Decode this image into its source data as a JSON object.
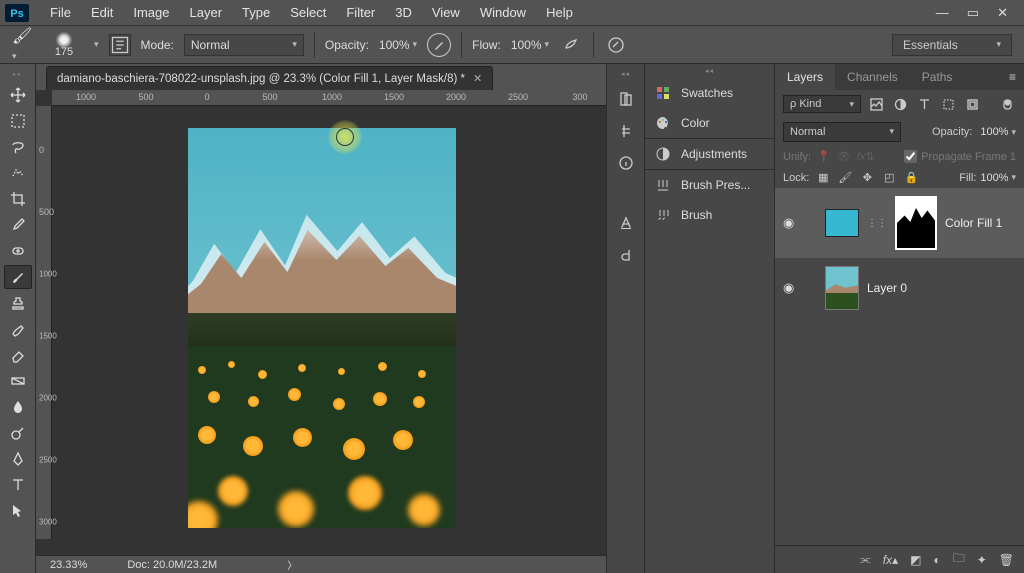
{
  "menubar": {
    "items": [
      "File",
      "Edit",
      "Image",
      "Layer",
      "Type",
      "Select",
      "Filter",
      "3D",
      "View",
      "Window",
      "Help"
    ]
  },
  "options": {
    "brush_size": "175",
    "mode_label": "Mode:",
    "mode_value": "Normal",
    "opacity_label": "Opacity:",
    "opacity_value": "100%",
    "flow_label": "Flow:",
    "flow_value": "100%"
  },
  "workspace": {
    "value": "Essentials"
  },
  "document": {
    "tab_title": "damiano-baschiera-708022-unsplash.jpg @ 23.3% (Color Fill 1, Layer Mask/8) *",
    "hruler_ticks": [
      "1000",
      "500",
      "0",
      "500",
      "1000",
      "1500",
      "2000",
      "2500",
      "300"
    ],
    "vruler_ticks": [
      "0",
      "500",
      "1000",
      "1500",
      "2000",
      "2500",
      "3000"
    ]
  },
  "status": {
    "zoom": "23.33%",
    "doc": "Doc: 20.0M/23.2M"
  },
  "panels": {
    "swatches": "Swatches",
    "color": "Color",
    "adjustments": "Adjustments",
    "brush_presets": "Brush Pres...",
    "brush": "Brush"
  },
  "layers_panel": {
    "tabs": [
      "Layers",
      "Channels",
      "Paths"
    ],
    "filter_kind_label": "Kind",
    "filter_kind_prefix": "ρ",
    "blend_mode": "Normal",
    "opacity_label": "Opacity:",
    "opacity_value": "100%",
    "unify_label": "Unify:",
    "propagate_label": "Propagate Frame 1",
    "lock_label": "Lock:",
    "fill_label": "Fill:",
    "fill_value": "100%",
    "layers": [
      {
        "name": "Color Fill 1"
      },
      {
        "name": "Layer 0"
      }
    ]
  }
}
